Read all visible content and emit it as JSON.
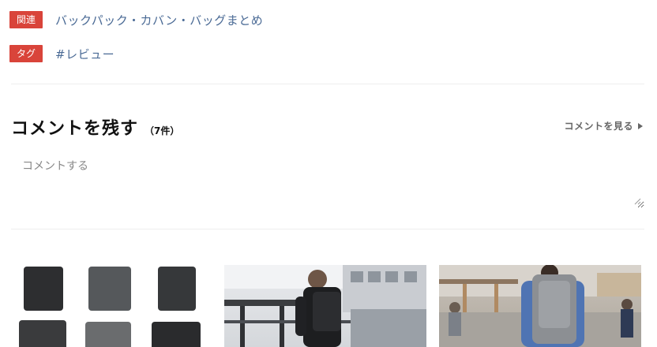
{
  "related": {
    "badge": "関連",
    "link": "バックパック・カバン・バッグまとめ"
  },
  "tag": {
    "badge": "タグ",
    "link": "#レビュー"
  },
  "comments": {
    "title": "コメントを残す",
    "count": "（7件）",
    "view_link": "コメントを見る",
    "placeholder": "コメントする"
  },
  "thumbnails": [
    {
      "name": "backpack-product-grid"
    },
    {
      "name": "man-with-backpack-station"
    },
    {
      "name": "man-with-backpack-street"
    }
  ],
  "colors": {
    "badge": "#d9443a",
    "link": "#4a6a95"
  }
}
